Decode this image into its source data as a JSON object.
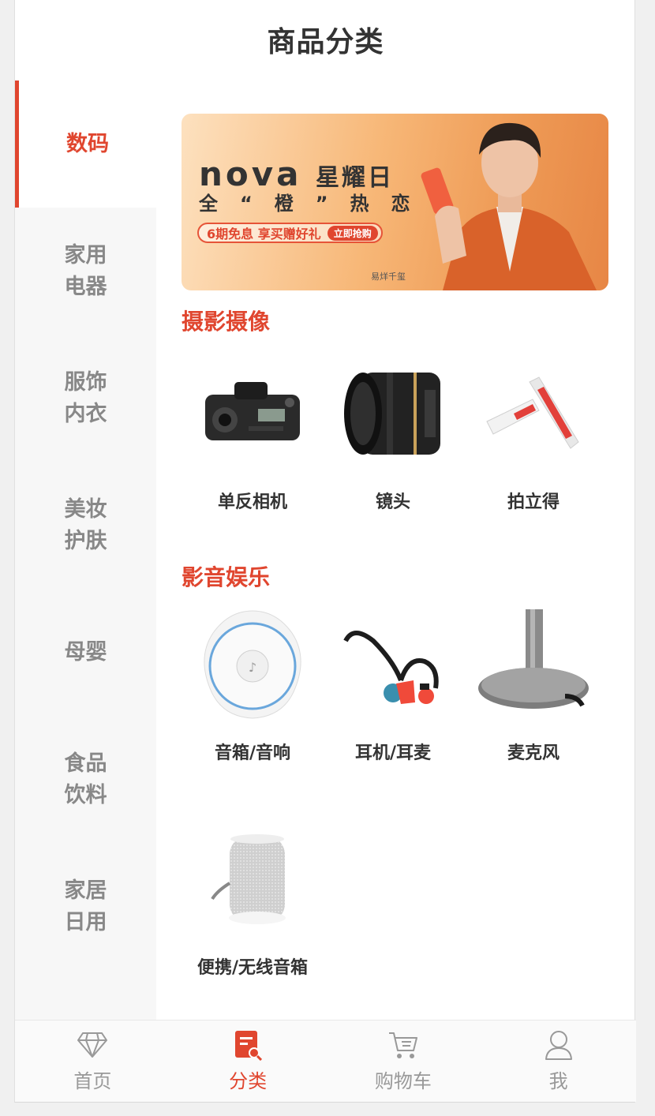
{
  "header": {
    "title": "商品分类"
  },
  "sidebar": {
    "items": [
      {
        "label": "数码",
        "active": true
      },
      {
        "label": "家用\n电器",
        "active": false
      },
      {
        "label": "服饰\n内衣",
        "active": false
      },
      {
        "label": "美妆\n护肤",
        "active": false
      },
      {
        "label": "母婴",
        "active": false
      },
      {
        "label": "食品\n饮料",
        "active": false
      },
      {
        "label": "家居\n日用",
        "active": false
      }
    ]
  },
  "banner": {
    "brand": "nova",
    "brand_suffix": "星耀日",
    "slogan": "全“橙”热恋",
    "promo": "6期免息 享买赠好礼",
    "promo_button": "立即抢购",
    "signature": "易烊千玺"
  },
  "sections": [
    {
      "title": "摄影摄像",
      "items": [
        {
          "label": "单反相机",
          "icon": "dslr-camera"
        },
        {
          "label": "镜头",
          "icon": "camera-lens"
        },
        {
          "label": "拍立得",
          "icon": "instant-camera"
        }
      ]
    },
    {
      "title": "影音娱乐",
      "items": [
        {
          "label": "音箱/音响",
          "icon": "smart-speaker"
        },
        {
          "label": "耳机/耳麦",
          "icon": "earphones"
        },
        {
          "label": "麦克风",
          "icon": "microphone"
        },
        {
          "label": "便携/无线音箱",
          "icon": "portable-speaker"
        }
      ]
    }
  ],
  "tabbar": {
    "items": [
      {
        "label": "首页",
        "icon": "diamond-icon",
        "active": false
      },
      {
        "label": "分类",
        "icon": "category-search-icon",
        "active": true
      },
      {
        "label": "购物车",
        "icon": "cart-icon",
        "active": false
      },
      {
        "label": "我",
        "icon": "user-icon",
        "active": false
      }
    ]
  },
  "colors": {
    "accent": "#e0462f",
    "sidebar_bg": "#f7f7f7",
    "text_muted": "#888888"
  }
}
